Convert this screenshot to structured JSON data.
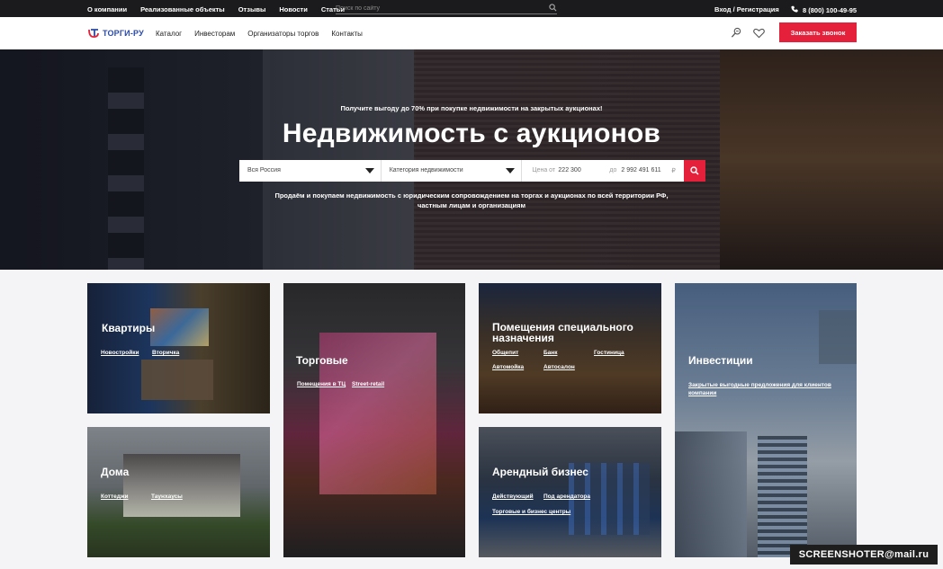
{
  "topbar": {
    "nav": [
      "О компании",
      "Реализованные объекты",
      "Отзывы",
      "Новости",
      "Статьи"
    ],
    "search_placeholder": "Поиск по сайту",
    "login": "Вход / Регистрация",
    "phone": "8 (800) 100-49-95"
  },
  "header": {
    "logo": "ТОРГИ-РУ",
    "nav": [
      "Каталог",
      "Инвесторам",
      "Организаторы торгов",
      "Контакты"
    ],
    "cta": "Заказать звонок"
  },
  "hero": {
    "subtitle": "Получите выгоду до 70% при покупке недвижимости на закрытых аукционах!",
    "title": "Недвижимость с аукционов",
    "region": "Вся Россия",
    "category": "Категория недвижимости",
    "price_from_label": "Цена от",
    "price_from": "222 300",
    "price_to_label": "до",
    "price_to": "2 992 491 611",
    "currency": "₽",
    "desc_line1": "Продаём и покупаем недвижимость с юридическим сопровождением на торгах и аукционах по всей территории РФ,",
    "desc_line2": "частным лицам и организациям"
  },
  "cards": {
    "apartments": {
      "title": "Квартиры",
      "links": [
        "Новостройки",
        "Вторичка"
      ]
    },
    "houses": {
      "title": "Дома",
      "links": [
        "Коттеджи",
        "Таунхаусы"
      ]
    },
    "retail": {
      "title": "Торговые",
      "links": [
        "Помещения в ТЦ",
        "Street-retail"
      ]
    },
    "special": {
      "title_1": "Помещения специального",
      "title_2": "назначения",
      "links": [
        "Общепит",
        "Банк",
        "Гостиница",
        "Автомойка",
        "Автосалон"
      ]
    },
    "rental": {
      "title": "Арендный бизнес",
      "links": [
        "Действующий",
        "Под арендатора",
        "Торговые и бизнес центры"
      ]
    },
    "invest": {
      "title": "Инвестиции",
      "link_1": "Закрытые выгодные предложения для клиентов",
      "link_2": "компании"
    }
  },
  "watermark": "SCREENSHOTER@mail.ru"
}
